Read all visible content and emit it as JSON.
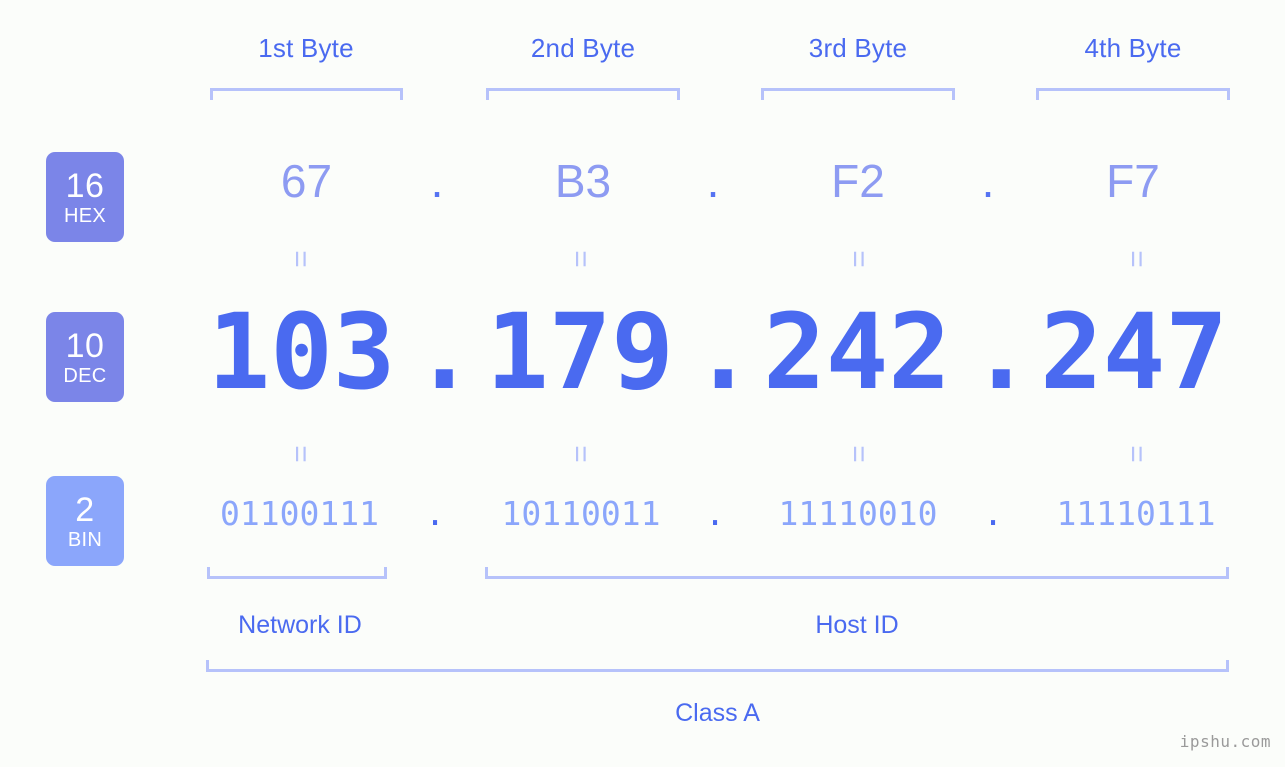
{
  "ip": "103.179.242.247",
  "header": {
    "byte_labels": [
      "1st Byte",
      "2nd Byte",
      "3rd Byte",
      "4th Byte"
    ]
  },
  "bases": [
    {
      "key": "hex",
      "number": "16",
      "name": "HEX",
      "color": "#7b85e8"
    },
    {
      "key": "dec",
      "number": "10",
      "name": "DEC",
      "color": "#7b85e8"
    },
    {
      "key": "bin",
      "number": "2",
      "name": "BIN",
      "color": "#8ba6fb"
    }
  ],
  "rows": {
    "hex": {
      "values": [
        "67",
        "B3",
        "F2",
        "F7"
      ],
      "separator": "."
    },
    "dec": {
      "values": [
        "103",
        "179",
        "242",
        "247"
      ],
      "separator": "."
    },
    "bin": {
      "values": [
        "01100111",
        "10110011",
        "11110010",
        "11110111"
      ],
      "separator": "."
    }
  },
  "equals_marks": {
    "hex_to_dec": [
      "=",
      "=",
      "=",
      "="
    ],
    "dec_to_bin": [
      "=",
      "=",
      "=",
      "="
    ]
  },
  "sections": {
    "network_id": "Network ID",
    "host_id": "Host ID",
    "class": "Class A"
  },
  "watermark": "ipshu.com",
  "colors": {
    "background": "#fbfdfa",
    "accent_strong": "#4a6af0",
    "accent_mid": "#8d9bf2",
    "accent_light": "#b6c2fa",
    "badge_dark": "#7b85e8",
    "badge_light": "#8ba6fb",
    "watermark": "#9a9a9a"
  }
}
